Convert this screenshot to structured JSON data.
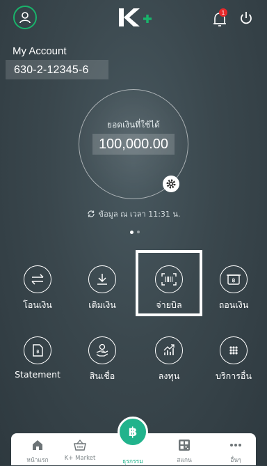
{
  "header": {
    "logo_text": "K+",
    "notification_count": "1"
  },
  "account": {
    "title": "My Account",
    "number": "630-2-12345-6"
  },
  "balance": {
    "label": "ยอดเงินที่ใช้ได้",
    "value": "100,000.00",
    "updated": "ข้อมูล ณ เวลา 11:31 น."
  },
  "pager": {
    "count": 2,
    "active": 1
  },
  "actions": [
    {
      "label": "โอนเงิน"
    },
    {
      "label": "เติมเงิน"
    },
    {
      "label": "จ่ายบิล"
    },
    {
      "label": "ถอนเงิน"
    },
    {
      "label": "Statement"
    },
    {
      "label": "สินเชื่อ"
    },
    {
      "label": "ลงทุน"
    },
    {
      "label": "บริการอื่น"
    }
  ],
  "nav": {
    "home": "หน้าแรก",
    "market": "K+ Market",
    "transactions": "ธุรกรรม",
    "scan": "สแกน",
    "more": "อื่นๆ"
  },
  "colors": {
    "brand_green": "#19b36b",
    "fab_green": "#21b38c",
    "badge_red": "#e8292b"
  }
}
